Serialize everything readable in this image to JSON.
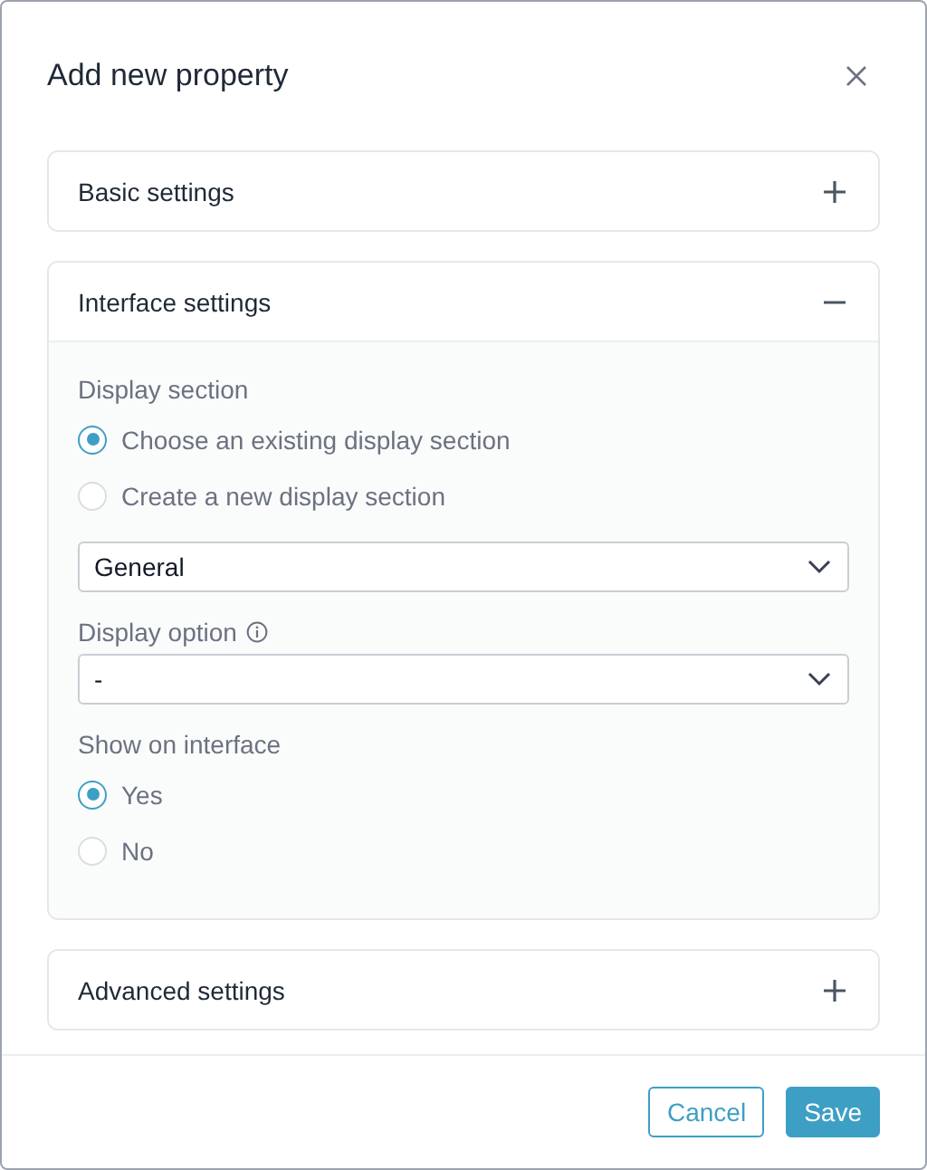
{
  "dialog": {
    "title": "Add new property"
  },
  "sections": [
    {
      "title": "Basic settings",
      "expanded": false
    },
    {
      "title": "Interface settings",
      "expanded": true,
      "fields": [
        {
          "kind": "radio",
          "label": "Display section",
          "options": [
            {
              "label": "Choose an existing display section",
              "selected": true
            },
            {
              "label": "Create a new display section",
              "selected": false
            }
          ]
        },
        {
          "kind": "select",
          "value": "General"
        },
        {
          "kind": "select",
          "label": "Display option",
          "info": true,
          "value": "-"
        },
        {
          "kind": "radio",
          "label": "Show on interface",
          "options": [
            {
              "label": "Yes",
              "selected": true
            },
            {
              "label": "No",
              "selected": false
            }
          ]
        }
      ]
    },
    {
      "title": "Advanced settings",
      "expanded": false
    }
  ],
  "buttons": [
    {
      "label": "Cancel",
      "kind": "secondary"
    },
    {
      "label": "Save",
      "kind": "primary"
    }
  ]
}
